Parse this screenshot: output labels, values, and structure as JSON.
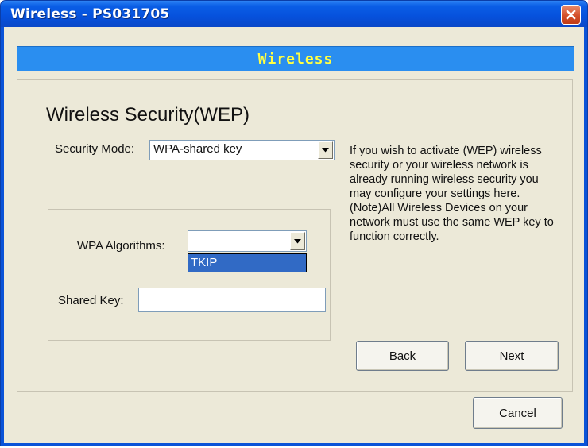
{
  "window": {
    "title": "Wireless - PS031705",
    "close_icon": "close-icon"
  },
  "banner": {
    "text": "Wireless"
  },
  "main": {
    "heading": "Wireless Security(WEP)",
    "security_mode": {
      "label": "Security Mode:",
      "value": "WPA-shared key"
    },
    "help_text": "If you wish to activate (WEP) wireless security or your wireless network is already running wireless security you may configure your settings here. (Note)All Wireless Devices on your network must use the same WEP key to function correctly.",
    "wpa_algorithms": {
      "label": "WPA Algorithms:",
      "value": "",
      "options": [
        "TKIP"
      ],
      "highlighted_option": "TKIP"
    },
    "shared_key": {
      "label": "Shared Key:",
      "value": ""
    },
    "buttons": {
      "back": "Back",
      "next": "Next"
    }
  },
  "footer": {
    "cancel": "Cancel"
  },
  "colors": {
    "title_bar": "#0a5ee6",
    "banner_bg": "#2a8ef0",
    "banner_text": "#ffff44",
    "dialog_bg": "#ece9d8",
    "selection": "#316ac5"
  }
}
